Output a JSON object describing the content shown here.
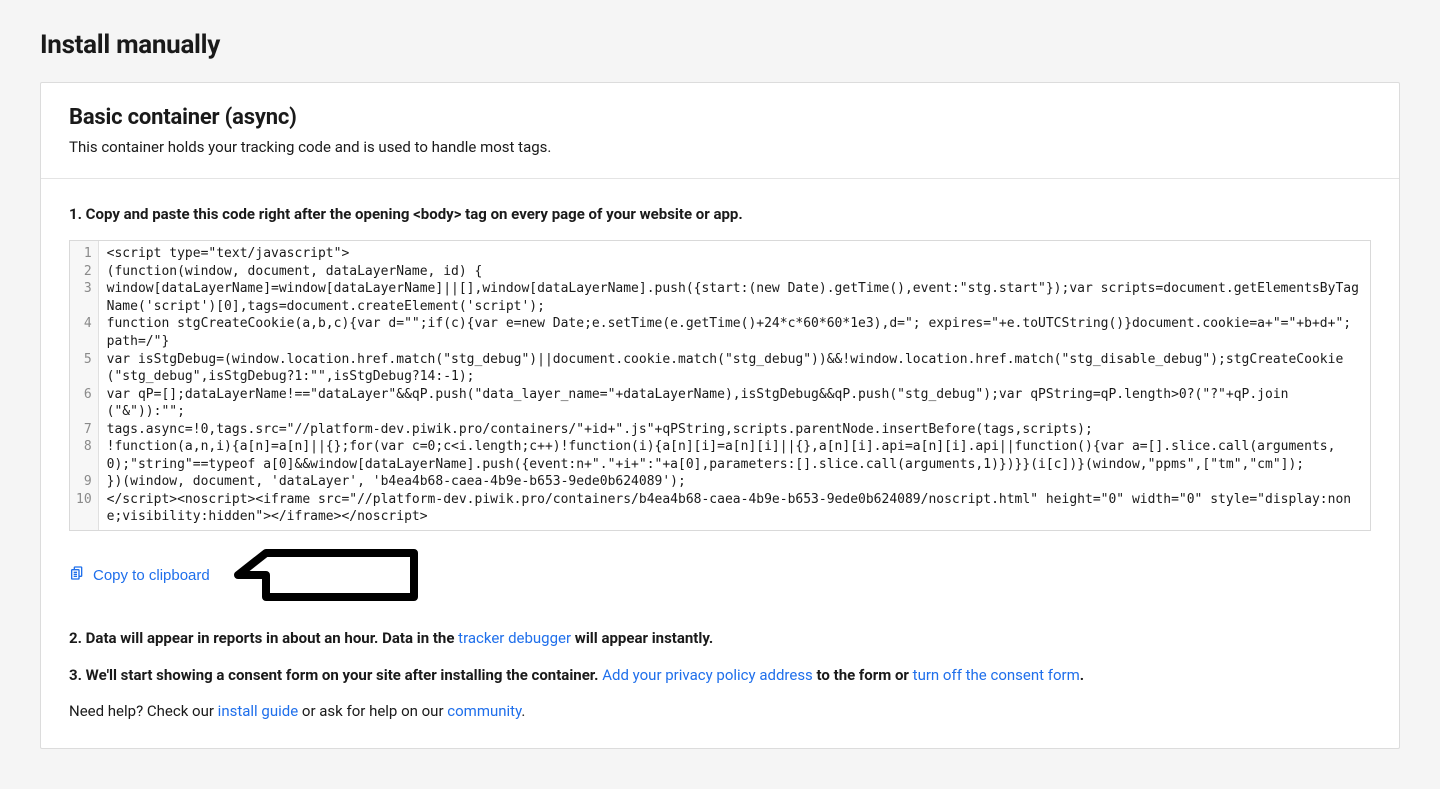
{
  "page_title": "Install manually",
  "card": {
    "title": "Basic container (async)",
    "subtitle": "This container holds your tracking code and is used to handle most tags."
  },
  "step1": {
    "prefix": "1. Copy and paste this code right after the opening ",
    "tag": "<body>",
    "suffix": " tag on every page of your website or app."
  },
  "code_lines": [
    "<script type=\"text/javascript\">",
    "(function(window, document, dataLayerName, id) {",
    "window[dataLayerName]=window[dataLayerName]||[],window[dataLayerName].push({start:(new Date).getTime(),event:\"stg.start\"});var scripts=document.getElementsByTagName('script')[0],tags=document.createElement('script');",
    "function stgCreateCookie(a,b,c){var d=\"\";if(c){var e=new Date;e.setTime(e.getTime()+24*c*60*60*1e3),d=\"; expires=\"+e.toUTCString()}document.cookie=a+\"=\"+b+d+\"; path=/\"}",
    "var isStgDebug=(window.location.href.match(\"stg_debug\")||document.cookie.match(\"stg_debug\"))&&!window.location.href.match(\"stg_disable_debug\");stgCreateCookie(\"stg_debug\",isStgDebug?1:\"\",isStgDebug?14:-1);",
    "var qP=[];dataLayerName!==\"dataLayer\"&&qP.push(\"data_layer_name=\"+dataLayerName),isStgDebug&&qP.push(\"stg_debug\");var qPString=qP.length>0?(\"?\"+qP.join(\"&\")):\"\";",
    "tags.async=!0,tags.src=\"//platform-dev.piwik.pro/containers/\"+id+\".js\"+qPString,scripts.parentNode.insertBefore(tags,scripts);",
    "!function(a,n,i){a[n]=a[n]||{};for(var c=0;c<i.length;c++)!function(i){a[n][i]=a[n][i]||{},a[n][i].api=a[n][i].api||function(){var a=[].slice.call(arguments,0);\"string\"==typeof a[0]&&window[dataLayerName].push({event:n+\".\"+i+\":\"+a[0],parameters:[].slice.call(arguments,1)})}}(i[c])}(window,\"ppms\",[\"tm\",\"cm\"]);",
    "})(window, document, 'dataLayer', 'b4ea4b68-caea-4b9e-b653-9ede0b624089');",
    "</script><noscript><iframe src=\"//platform-dev.piwik.pro/containers/b4ea4b68-caea-4b9e-b653-9ede0b624089/noscript.html\" height=\"0\" width=\"0\" style=\"display:none;visibility:hidden\"></iframe></noscript>"
  ],
  "copy_label": "Copy to clipboard",
  "step2": {
    "prefix": "2. Data will appear in reports in about an hour. Data in the ",
    "link": "tracker debugger",
    "suffix": " will appear instantly."
  },
  "step3": {
    "prefix": "3. We'll start showing a consent form on your site after installing the container. ",
    "link1": "Add your privacy policy address",
    "mid": " to the form or ",
    "link2": "turn off the consent form",
    "suffix": "."
  },
  "help": {
    "prefix": "Need help? Check our ",
    "link1": "install guide",
    "mid": " or ask for help on our ",
    "link2": "community",
    "suffix": "."
  }
}
